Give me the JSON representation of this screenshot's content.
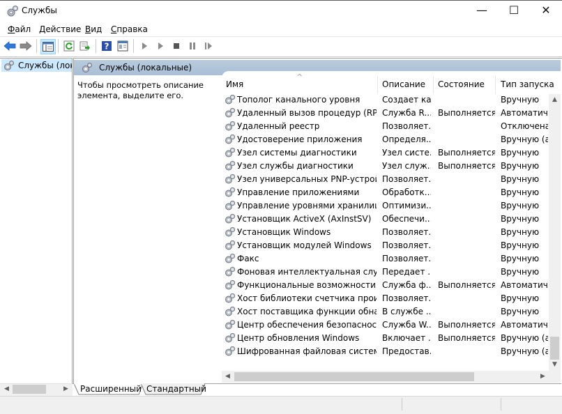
{
  "window": {
    "title": "Службы",
    "controls": {
      "minimize": "—",
      "maximize": "☐",
      "close": "✕"
    }
  },
  "menu": [
    {
      "label": "Файл",
      "accel": "Ф",
      "rest": "айл"
    },
    {
      "label": "Действие",
      "accel": "Д",
      "rest": "ействие"
    },
    {
      "label": "Вид",
      "accel": "В",
      "rest": "ид"
    },
    {
      "label": "Справка",
      "accel": "С",
      "rest": "правка"
    }
  ],
  "toolbar": {
    "buttons": [
      "back-arrow-icon",
      "forward-arrow-icon",
      "show-hide-tree-icon",
      "refresh-icon",
      "export-list-icon",
      "help-icon",
      "properties-icon",
      "start-service-icon",
      "start-service-alt-icon",
      "stop-service-icon",
      "pause-service-icon",
      "restart-service-icon"
    ]
  },
  "tree": {
    "item_label": "Службы (локальные)"
  },
  "pane": {
    "title": "Службы (локальные)",
    "description": "Чтобы просмотреть описание элемента, выделите его."
  },
  "columns": {
    "name": "Имя",
    "description": "Описание",
    "status": "Состояние",
    "startup": "Тип запуска",
    "sort_indicator": "^"
  },
  "services": [
    {
      "name": "Тополог канального уровня",
      "description": "Создает ка...",
      "status": "",
      "startup": "Вручную"
    },
    {
      "name": "Удаленный вызов процедур (RPC)",
      "description": "Служба R...",
      "status": "Выполняется",
      "startup": "Автоматиче..."
    },
    {
      "name": "Удаленный реестр",
      "description": "Позволяет...",
      "status": "",
      "startup": "Отключена"
    },
    {
      "name": "Удостоверение приложения",
      "description": "Определя...",
      "status": "",
      "startup": "Вручную (ак..."
    },
    {
      "name": "Узел системы диагностики",
      "description": "Узел систе...",
      "status": "Выполняется",
      "startup": "Вручную"
    },
    {
      "name": "Узел службы диагностики",
      "description": "Узел служ...",
      "status": "Выполняется",
      "startup": "Вручную"
    },
    {
      "name": "Узел универсальных PNP-устройств",
      "description": "Позволяет...",
      "status": "",
      "startup": "Вручную"
    },
    {
      "name": "Управление приложениями",
      "description": "Обработк...",
      "status": "",
      "startup": "Вручную"
    },
    {
      "name": "Управление уровнями хранилища",
      "description": "Оптимизи...",
      "status": "",
      "startup": "Вручную"
    },
    {
      "name": "Установщик ActiveX (AxInstSV)",
      "description": "Обеспечи...",
      "status": "",
      "startup": "Вручную"
    },
    {
      "name": "Установщик Windows",
      "description": "Позволяет...",
      "status": "",
      "startup": "Вручную"
    },
    {
      "name": "Установщик модулей Windows",
      "description": "Позволяет...",
      "status": "",
      "startup": "Вручную"
    },
    {
      "name": "Факс",
      "description": "Позволяет...",
      "status": "",
      "startup": "Вручную"
    },
    {
      "name": "Фоновая интеллектуальная служба...",
      "description": "Передает ...",
      "status": "",
      "startup": "Вручную"
    },
    {
      "name": "Функциональные возможности дл...",
      "description": "Служба ф...",
      "status": "Выполняется",
      "startup": "Автоматиче..."
    },
    {
      "name": "Хост библиотеки счетчика произв...",
      "description": "Позволяет...",
      "status": "",
      "startup": "Вручную"
    },
    {
      "name": "Хост поставщика функции обнару...",
      "description": "В службе ...",
      "status": "",
      "startup": "Вручную"
    },
    {
      "name": "Центр обеспечения безопасности",
      "description": "Служба W...",
      "status": "Выполняется",
      "startup": "Автоматиче..."
    },
    {
      "name": "Центр обновления Windows",
      "description": "Включает ...",
      "status": "Выполняется",
      "startup": "Вручную (ак..."
    },
    {
      "name": "Шифрованная файловая система (...",
      "description": "Предостав...",
      "status": "",
      "startup": "Вручную (ак..."
    }
  ],
  "tabs": [
    {
      "label": "Расширенный",
      "active": true
    },
    {
      "label": "Стандартный",
      "active": false
    }
  ],
  "colors": {
    "accent": "#cce8ff",
    "header_blue": "#b0c4db",
    "arrow_blue": "#2f78d8"
  }
}
